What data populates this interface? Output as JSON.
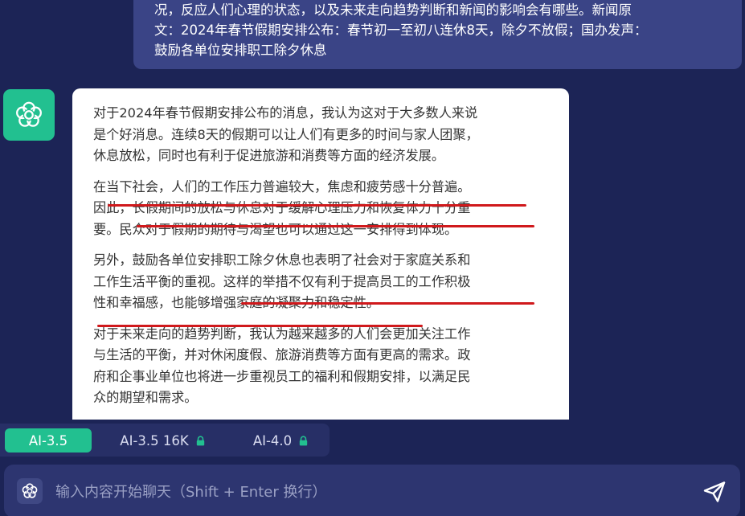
{
  "user_message": {
    "lines": [
      "况，反应人们心理的状态，以及未来走向趋势判断和新闻的影响会有哪些。新闻原",
      "文：2024年春节假期安排公布：春节初一至初八连休8天，除夕不放假；国办发声：",
      "鼓励各单位安排职工除夕休息"
    ]
  },
  "assistant_message": {
    "paragraphs": [
      [
        "对于2024年春节假期安排公布的消息，我认为这对于大多数人来说",
        "是个好消息。连续8天的假期可以让人们有更多的时间与家人团聚，",
        "休息放松，同时也有利于促进旅游和消费等方面的经济发展。"
      ],
      [
        "在当下社会，人们的工作压力普遍较大，焦虑和疲劳感十分普遍。",
        "因此，长假期间的放松与休息对于缓解心理压力和恢复体力十分重",
        "要。民众对于假期的期待与渴望也可以通过这一安排得到体现。"
      ],
      [
        "另外，鼓励各单位安排职工除夕休息也表明了社会对于家庭关系和",
        "工作生活平衡的重视。这样的举措不仅有利于提高员工的工作积极",
        "性和幸福感，也能够增强家庭的凝聚力和稳定性。"
      ],
      [
        "对于未来走向的趋势判断，我认为越来越多的人们会更加关注工作",
        "与生活的平衡，并对休闲度假、旅游消费等方面有更高的需求。政",
        "府和企事业单位也将进一步重视员工的福利和假期安排，以满足民",
        "众的期望和需求。"
      ]
    ]
  },
  "models": [
    {
      "label": "AI-3.5",
      "active": true,
      "locked": false
    },
    {
      "label": "AI-3.5 16K",
      "active": false,
      "locked": true
    },
    {
      "label": "AI-4.0",
      "active": false,
      "locked": true
    }
  ],
  "input": {
    "placeholder": "输入内容开始聊天（Shift + Enter 换行）",
    "value": ""
  },
  "colors": {
    "background": "#1c2456",
    "accent": "#22c090",
    "highlight_underline": "#d0191c",
    "user_bubble": "#3a4486"
  },
  "icons": {
    "avatar": "flower-icon",
    "lock": "lock-icon",
    "input_prefix": "flower-icon",
    "send": "send-icon"
  }
}
